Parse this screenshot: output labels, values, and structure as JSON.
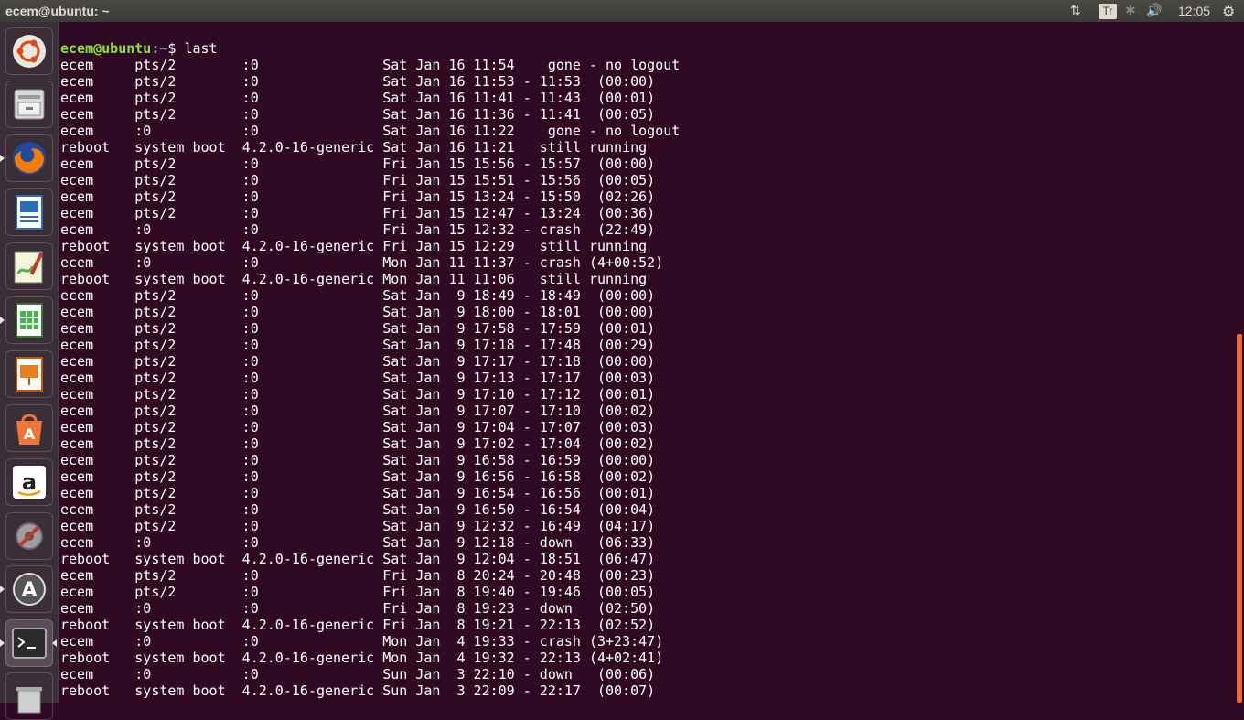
{
  "window": {
    "title": "ecem@ubuntu: ~"
  },
  "indicators": {
    "network": "⇅",
    "keyboard": "Tr",
    "bluetooth": "✱",
    "volume": "🔊",
    "time": "12:05",
    "session": "⚙"
  },
  "launcher": [
    {
      "name": "ubuntu-dash-icon",
      "color": "#e0e0d8"
    },
    {
      "name": "files-icon",
      "color": "#cfcfcf"
    },
    {
      "name": "firefox-icon",
      "color": "#e66000"
    },
    {
      "name": "libreoffice-writer-icon",
      "color": "#2a6ebb"
    },
    {
      "name": "gedit-icon",
      "color": "#7db54a"
    },
    {
      "name": "libreoffice-calc-icon",
      "color": "#4caf50"
    },
    {
      "name": "libreoffice-impress-icon",
      "color": "#d35400"
    },
    {
      "name": "ubuntu-software-icon",
      "color": "#f07538"
    },
    {
      "name": "amazon-icon",
      "color": "#ffffff"
    },
    {
      "name": "system-settings-icon",
      "color": "#bcbcbc"
    },
    {
      "name": "software-updater-icon",
      "color": "#666666"
    },
    {
      "name": "terminal-icon",
      "color": "#2b2b2b"
    },
    {
      "name": "trash-icon",
      "color": "#bbbbbb"
    }
  ],
  "prompt": {
    "user": "ecem@ubuntu",
    "path": ":~",
    "symbol": "$ ",
    "command": "last"
  },
  "lines": [
    "ecem     pts/2        :0               Sat Jan 16 11:54    gone - no logout",
    "ecem     pts/2        :0               Sat Jan 16 11:53 - 11:53  (00:00)",
    "ecem     pts/2        :0               Sat Jan 16 11:41 - 11:43  (00:01)",
    "ecem     pts/2        :0               Sat Jan 16 11:36 - 11:41  (00:05)",
    "ecem     :0           :0               Sat Jan 16 11:22    gone - no logout",
    "reboot   system boot  4.2.0-16-generic Sat Jan 16 11:21   still running",
    "ecem     pts/2        :0               Fri Jan 15 15:56 - 15:57  (00:00)",
    "ecem     pts/2        :0               Fri Jan 15 15:51 - 15:56  (00:05)",
    "ecem     pts/2        :0               Fri Jan 15 13:24 - 15:50  (02:26)",
    "ecem     pts/2        :0               Fri Jan 15 12:47 - 13:24  (00:36)",
    "ecem     :0           :0               Fri Jan 15 12:32 - crash  (22:49)",
    "reboot   system boot  4.2.0-16-generic Fri Jan 15 12:29   still running",
    "ecem     :0           :0               Mon Jan 11 11:37 - crash (4+00:52)",
    "reboot   system boot  4.2.0-16-generic Mon Jan 11 11:06   still running",
    "ecem     pts/2        :0               Sat Jan  9 18:49 - 18:49  (00:00)",
    "ecem     pts/2        :0               Sat Jan  9 18:00 - 18:01  (00:00)",
    "ecem     pts/2        :0               Sat Jan  9 17:58 - 17:59  (00:01)",
    "ecem     pts/2        :0               Sat Jan  9 17:18 - 17:48  (00:29)",
    "ecem     pts/2        :0               Sat Jan  9 17:17 - 17:18  (00:00)",
    "ecem     pts/2        :0               Sat Jan  9 17:13 - 17:17  (00:03)",
    "ecem     pts/2        :0               Sat Jan  9 17:10 - 17:12  (00:01)",
    "ecem     pts/2        :0               Sat Jan  9 17:07 - 17:10  (00:02)",
    "ecem     pts/2        :0               Sat Jan  9 17:04 - 17:07  (00:03)",
    "ecem     pts/2        :0               Sat Jan  9 17:02 - 17:04  (00:02)",
    "ecem     pts/2        :0               Sat Jan  9 16:58 - 16:59  (00:00)",
    "ecem     pts/2        :0               Sat Jan  9 16:56 - 16:58  (00:02)",
    "ecem     pts/2        :0               Sat Jan  9 16:54 - 16:56  (00:01)",
    "ecem     pts/2        :0               Sat Jan  9 16:50 - 16:54  (00:04)",
    "ecem     pts/2        :0               Sat Jan  9 12:32 - 16:49  (04:17)",
    "ecem     :0           :0               Sat Jan  9 12:18 - down   (06:33)",
    "reboot   system boot  4.2.0-16-generic Sat Jan  9 12:04 - 18:51  (06:47)",
    "ecem     pts/2        :0               Fri Jan  8 20:24 - 20:48  (00:23)",
    "ecem     pts/2        :0               Fri Jan  8 19:40 - 19:46  (00:05)",
    "ecem     :0           :0               Fri Jan  8 19:23 - down   (02:50)",
    "reboot   system boot  4.2.0-16-generic Fri Jan  8 19:21 - 22:13  (02:52)",
    "ecem     :0           :0               Mon Jan  4 19:33 - crash (3+23:47)",
    "reboot   system boot  4.2.0-16-generic Mon Jan  4 19:32 - 22:13 (4+02:41)",
    "ecem     :0           :0               Sun Jan  3 22:10 - down   (00:06)",
    "reboot   system boot  4.2.0-16-generic Sun Jan  3 22:09 - 22:17  (00:07)"
  ]
}
